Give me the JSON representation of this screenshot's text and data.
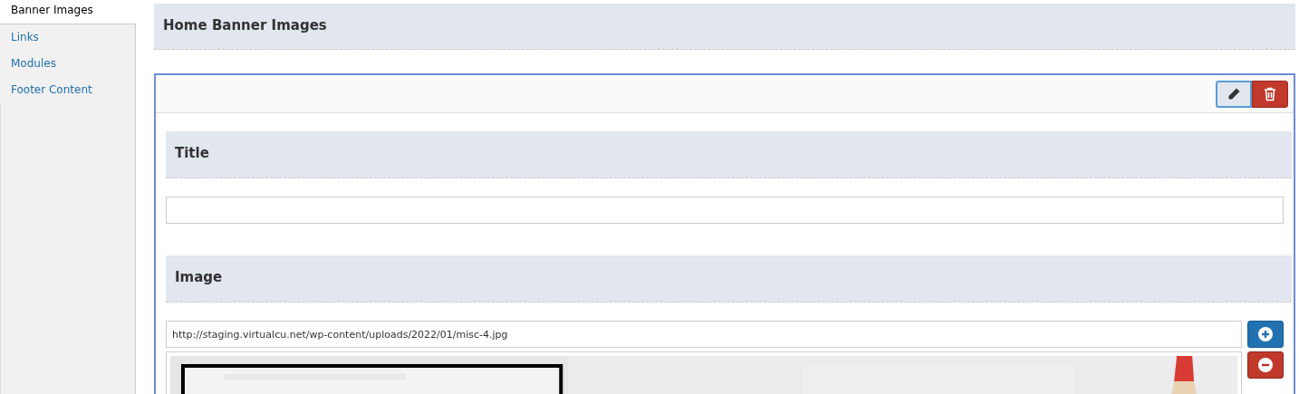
{
  "tabs": [
    {
      "label": "Banner Images",
      "selected": true
    },
    {
      "label": "Links",
      "selected": false
    },
    {
      "label": "Modules",
      "selected": false
    },
    {
      "label": "Footer Content",
      "selected": false
    }
  ],
  "page_heading": "Home Banner Images",
  "item": {
    "sections": [
      {
        "kind": "text",
        "heading": "Title"
      },
      {
        "heading": "Image",
        "value": "http://staging.virtualcu.net/wp-content/uploads/2022/01/misc-4.jpg"
      }
    ]
  }
}
